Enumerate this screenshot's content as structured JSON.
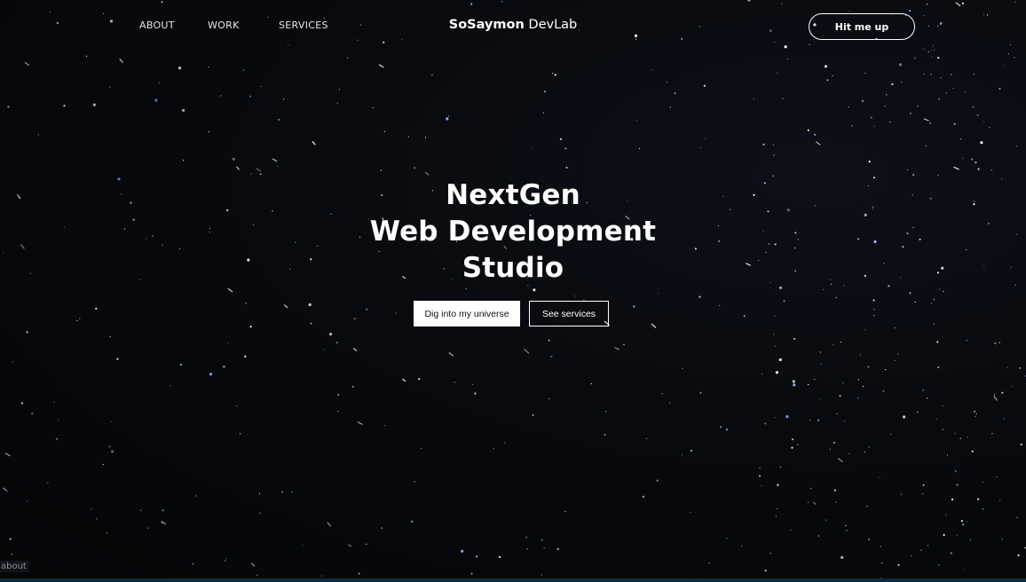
{
  "nav": {
    "items": [
      {
        "label": "ABOUT"
      },
      {
        "label": "WORK"
      },
      {
        "label": "SERVICES"
      }
    ]
  },
  "brand": {
    "name_bold": "SoSaymon",
    "name_light": "DevLab"
  },
  "header": {
    "cta_label": "Hit me up"
  },
  "hero": {
    "title_lines": [
      "NextGen",
      "Web Development",
      "Studio"
    ],
    "primary_button": "Dig into my universe",
    "secondary_button": "See services"
  },
  "status_bar": {
    "link_preview": "about"
  },
  "colors": {
    "background": "#07080c",
    "foreground": "#ffffff",
    "star_tint": "#cfe0ff"
  }
}
